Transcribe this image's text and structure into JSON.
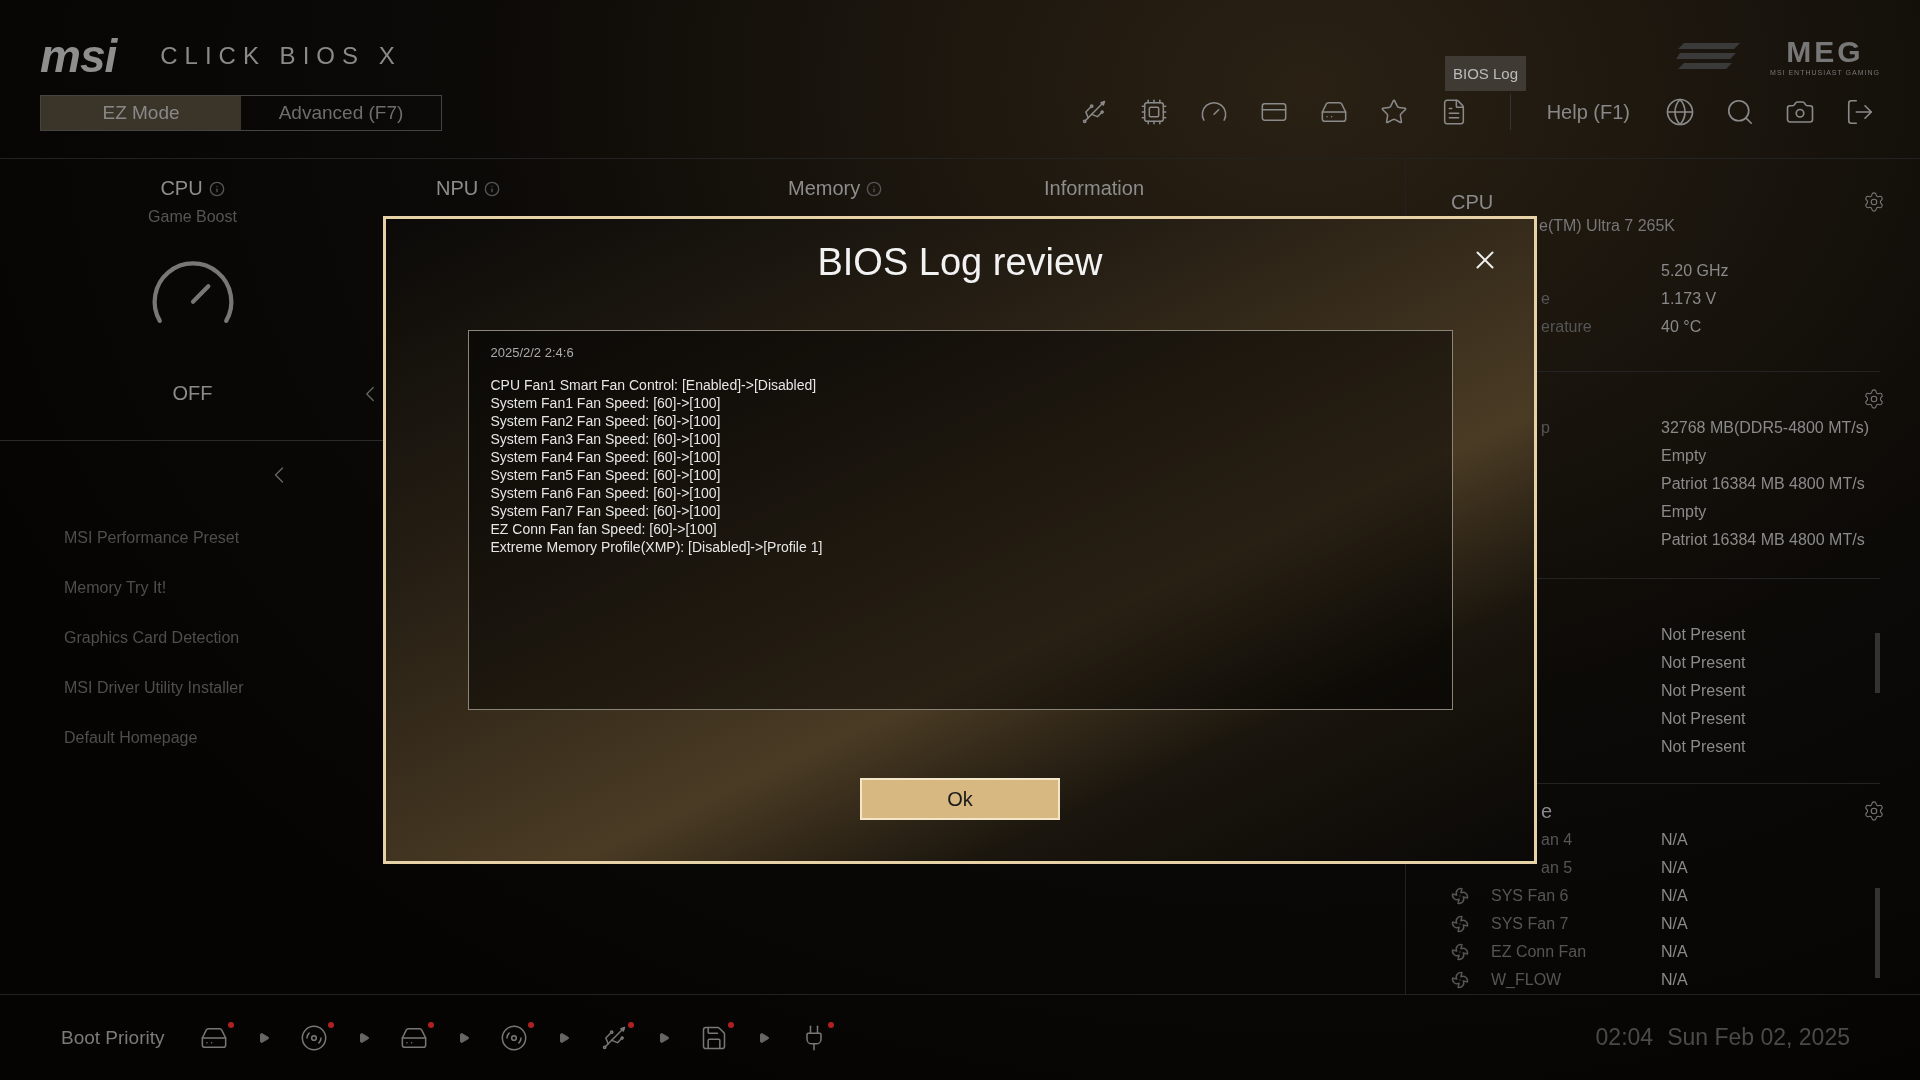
{
  "header": {
    "brand": "msi",
    "product": "CLICK BIOS X",
    "badge": "BIOS Log",
    "meg": {
      "mark": "MEG",
      "tagline": "MSI ENTHUSIAST GAMING"
    },
    "help": "Help (F1)"
  },
  "modes": [
    {
      "label": "EZ Mode",
      "selected": true
    },
    {
      "label": "Advanced (F7)",
      "selected": false
    }
  ],
  "overview": {
    "cpu": {
      "title": "CPU",
      "subtitle": "Game Boost",
      "state": "OFF"
    },
    "columns": [
      {
        "title": "NPU",
        "info": true
      },
      {
        "title": "Memory",
        "info": true
      },
      {
        "title": "Information",
        "info": false
      }
    ]
  },
  "menu": [
    "MSI Performance Preset",
    "Memory Try It!",
    "Graphics Card Detection",
    "MSI Driver Utility Installer",
    "Default Homepage"
  ],
  "system_panel": {
    "sections": [
      {
        "kind": "cpu",
        "title": "CPU",
        "subtitle": "e(TM) Ultra 7 265K",
        "rows": [
          {
            "value": "5.20 GHz"
          },
          {
            "label": "e",
            "value": "1.173 V"
          },
          {
            "label": "erature",
            "value": "40 °C"
          }
        ]
      },
      {
        "kind": "memory",
        "rows": [
          {
            "label": "p",
            "value": "32768 MB(DDR5-4800 MT/s)"
          },
          {
            "value": "Empty"
          },
          {
            "value": "Patriot 16384 MB 4800 MT/s"
          },
          {
            "value": "Empty"
          },
          {
            "value": "Patriot 16384 MB 4800 MT/s"
          }
        ]
      },
      {
        "kind": "devices",
        "rows": [
          {
            "value": "Not Present"
          },
          {
            "value": "Not Present"
          },
          {
            "value": "Not Present"
          },
          {
            "value": "Not Present"
          },
          {
            "value": "Not Present"
          }
        ]
      },
      {
        "kind": "fans",
        "title": "e",
        "rows": [
          {
            "label": "an 4",
            "value": "N/A",
            "icon": false
          },
          {
            "label": "an 5",
            "value": "N/A",
            "icon": false
          },
          {
            "label": "SYS Fan 6",
            "value": "N/A",
            "icon": true
          },
          {
            "label": "SYS Fan 7",
            "value": "N/A",
            "icon": true
          },
          {
            "label": "EZ Conn Fan",
            "value": "N/A",
            "icon": true
          },
          {
            "label": "W_FLOW",
            "value": "N/A",
            "icon": true
          }
        ]
      }
    ]
  },
  "boot_priority": {
    "label": "Boot Priority",
    "devices": [
      {
        "kind": "drive"
      },
      {
        "kind": "disc"
      },
      {
        "kind": "drive"
      },
      {
        "kind": "disc"
      },
      {
        "kind": "usb"
      },
      {
        "kind": "card"
      },
      {
        "kind": "plug"
      }
    ]
  },
  "clock": {
    "time": "02:04",
    "date": "Sun Feb 02, 2025"
  },
  "dialog": {
    "title": "BIOS Log review",
    "timestamp": "2025/2/2 2:4:6",
    "entries": [
      "CPU Fan1 Smart Fan Control: [Enabled]->[Disabled]",
      "System Fan1 Fan Speed: [60]->[100]",
      "System Fan2 Fan Speed: [60]->[100]",
      "System Fan3 Fan Speed: [60]->[100]",
      "System Fan4 Fan Speed: [60]->[100]",
      "System Fan5 Fan Speed: [60]->[100]",
      "System Fan6 Fan Speed: [60]->[100]",
      "System Fan7 Fan Speed: [60]->[100]",
      "EZ Conn Fan fan Speed: [60]->[100]",
      "Extreme Memory Profile(XMP): [Disabled]->[Profile 1]"
    ],
    "button": "Ok"
  }
}
